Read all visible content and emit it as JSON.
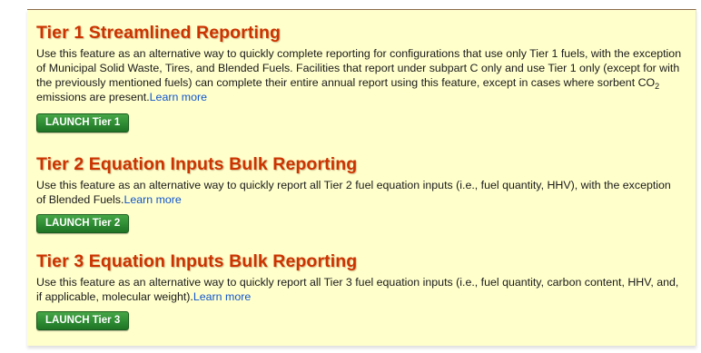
{
  "sections": [
    {
      "title": "Tier 1 Streamlined Reporting",
      "text_before_sub": "Use this feature as an alternative way to quickly complete reporting for configurations that use only Tier 1 fuels, with the exception of Municipal Solid Waste, Tires, and Blended Fuels. Facilities that report under subpart C only and use Tier 1 only (except for with the previously mentioned fuels) can complete their entire annual report using this feature, except in cases where sorbent CO",
      "subscript": "2",
      "text_after_sub": " emissions are present.",
      "learn_more": "Learn more",
      "button": "LAUNCH Tier 1"
    },
    {
      "title": "Tier 2 Equation Inputs Bulk Reporting",
      "text": "Use this feature as an alternative way to quickly report all Tier 2 fuel equation inputs (i.e., fuel quantity, HHV), with the exception of Blended Fuels.",
      "learn_more": "Learn more",
      "button": "LAUNCH Tier 2"
    },
    {
      "title": "Tier 3 Equation Inputs Bulk Reporting",
      "text": "Use this feature as an alternative way to quickly report all Tier 3 fuel equation inputs (i.e., fuel quantity, carbon content, HHV, and, if applicable, molecular weight).",
      "learn_more": "Learn more",
      "button": "LAUNCH Tier 3"
    }
  ],
  "colors": {
    "panel_background": "#ffffcc",
    "heading": "#cc3300",
    "link": "#1155cc",
    "button": "#2e8b33"
  }
}
